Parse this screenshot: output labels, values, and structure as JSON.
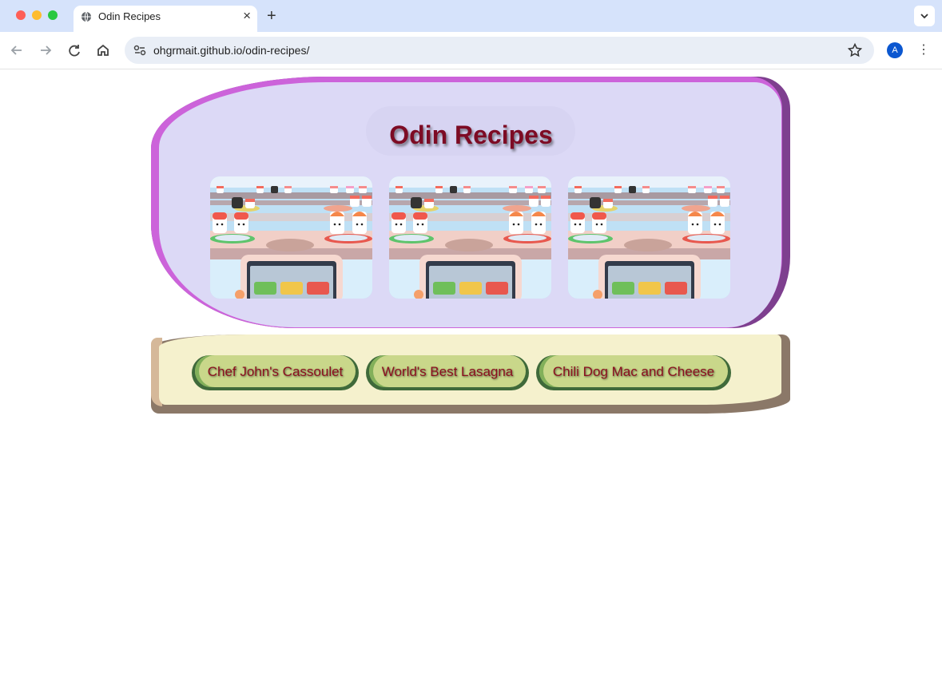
{
  "browser": {
    "tab_title": "Odin Recipes",
    "tab_close": "×",
    "new_tab": "+",
    "url": "ohgrmait.github.io/odin-recipes/",
    "profile_initial": "A",
    "menu": "⋮"
  },
  "page": {
    "title": "Odin Recipes",
    "thumbnails": [
      {
        "icon": "sushi-conveyor-image"
      },
      {
        "icon": "sushi-conveyor-image"
      },
      {
        "icon": "sushi-conveyor-image"
      }
    ],
    "recipe_links": [
      {
        "label": "Chef John's Cassoulet"
      },
      {
        "label": "World's Best Lasagna"
      },
      {
        "label": "Chili Dog Mac and Cheese"
      }
    ]
  },
  "colors": {
    "title": "#7d0b24",
    "header_band": "#cc63da",
    "header_fill": "#dcd9f6",
    "nav_fill": "#f5f1cd",
    "link_fill": "#c9d78a",
    "link_text": "#8b0f1f"
  }
}
